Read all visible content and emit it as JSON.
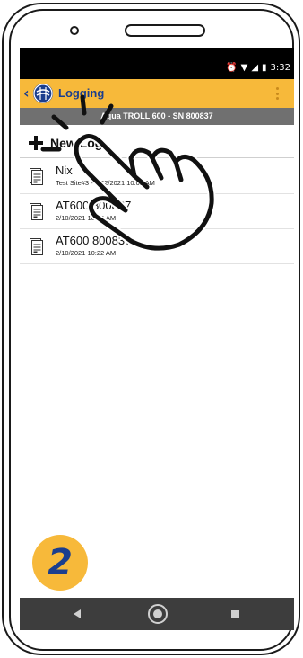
{
  "status_bar": {
    "time": "3:32",
    "icons": [
      "alarm-icon",
      "wifi-icon",
      "signal-icon",
      "battery-icon"
    ]
  },
  "app_bar": {
    "back_icon": "chevron-left-icon",
    "logo_icon": "app-logo-icon",
    "title": "Logging",
    "menu_icon": "overflow-menu-icon"
  },
  "device_bar": {
    "text": "Aqua TROLL 600 - SN 800837"
  },
  "new_log": {
    "icon": "plus-icon",
    "label": "New Log"
  },
  "logs": [
    {
      "name": "Nix",
      "subtitle": "Test Site#3 - 2/22/2021 10:03 AM",
      "icon": "document-icon"
    },
    {
      "name": "AT600 800837",
      "subtitle": "2/10/2021 10:45 AM",
      "icon": "document-icon"
    },
    {
      "name": "AT600 800837",
      "subtitle": "2/10/2021 10:22 AM",
      "icon": "document-icon"
    }
  ],
  "step_badge": "2",
  "nav_bar": {
    "back_icon": "nav-back-icon",
    "home_icon": "nav-home-icon",
    "recents_icon": "nav-recents-icon"
  },
  "colors": {
    "accent": "#f7b93a",
    "brand_blue": "#1b3e8e",
    "device_bar": "#707070",
    "nav_bar": "#3d3d3d"
  }
}
